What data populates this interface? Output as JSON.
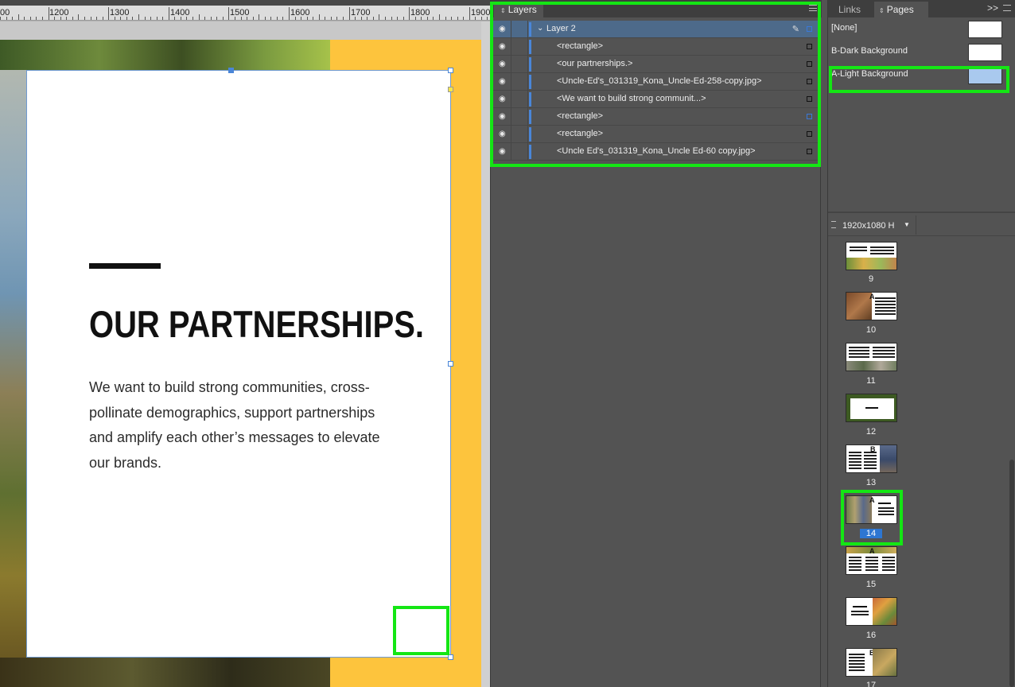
{
  "ruler": {
    "labels": [
      "00",
      "1200",
      "1300",
      "1400",
      "1500",
      "1600",
      "1700",
      "1800",
      "1900"
    ]
  },
  "document": {
    "headline": "OUR PARTNERSHIPS.",
    "body": "We want to build strong communities, cross-pollinate demographics, support partnerships and amplify each other’s messages to elevate our brands."
  },
  "layers_panel": {
    "tab_label": "Layers",
    "rows": [
      {
        "name": "Layer 2",
        "selected": true,
        "kind": "layer"
      },
      {
        "name": "<rectangle>"
      },
      {
        "name": "<our partnerships.>"
      },
      {
        "name": "<Uncle-Ed's_031319_Kona_Uncle-Ed-258-copy.jpg>"
      },
      {
        "name": "<We want to build strong communit...>"
      },
      {
        "name": "<rectangle>",
        "highlight_square": true
      },
      {
        "name": "<rectangle>"
      },
      {
        "name": "<Uncle Ed's_031319_Kona_Uncle Ed-60 copy.jpg>"
      }
    ]
  },
  "right_panel": {
    "tabs": {
      "links": "Links",
      "pages": "Pages"
    },
    "collapse_icon": ">>",
    "masters": [
      {
        "name": "[None]",
        "color": "#ffffff"
      },
      {
        "name": "B-Dark Background",
        "color": "#ffffff"
      },
      {
        "name": "A-Light Background",
        "color": "#a9c9ee"
      }
    ],
    "page_size": "1920x1080 H",
    "pages": [
      {
        "number": "9"
      },
      {
        "number": "10",
        "master": "A"
      },
      {
        "number": "11"
      },
      {
        "number": "12"
      },
      {
        "number": "13",
        "master": "B"
      },
      {
        "number": "14",
        "master": "A",
        "selected": true
      },
      {
        "number": "15",
        "master": "A"
      },
      {
        "number": "16"
      },
      {
        "number": "17",
        "master": "B"
      }
    ]
  },
  "colors": {
    "highlight_outline": "#14e614",
    "selection_blue": "#2d76d2",
    "accent_yellow": "#fdc43d"
  }
}
